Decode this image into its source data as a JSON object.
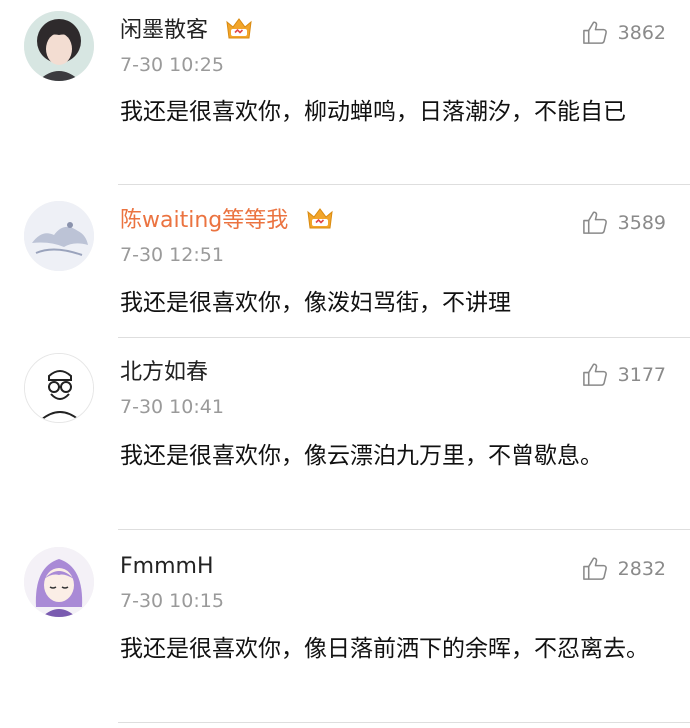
{
  "comments": [
    {
      "username": "闲墨散客",
      "vip": false,
      "timestamp": "7-30 10:25",
      "likes": "3862",
      "text": "我还是很喜欢你，柳动蝉鸣，日落潮汐，不能自已"
    },
    {
      "username": "陈waiting等等我",
      "vip": true,
      "timestamp": "7-30 12:51",
      "likes": "3589",
      "text": "我还是很喜欢你，像泼妇骂街，不讲理"
    },
    {
      "username": "北方如春",
      "vip": false,
      "timestamp": "7-30 10:41",
      "likes": "3177",
      "text": "我还是很喜欢你，像云漂泊九万里，不曾歇息。"
    },
    {
      "username": "FmmmH",
      "vip": false,
      "timestamp": "7-30 10:15",
      "likes": "2832",
      "text": "我还是很喜欢你，像日落前洒下的余晖，不忍离去。"
    }
  ],
  "colors": {
    "vip_name": "#eb7340",
    "crown": "#f2a52a",
    "meta": "#9a9a9a",
    "divider": "#dedede"
  },
  "icons": {
    "like": "thumbs-up-icon",
    "badge": "crown-icon"
  }
}
